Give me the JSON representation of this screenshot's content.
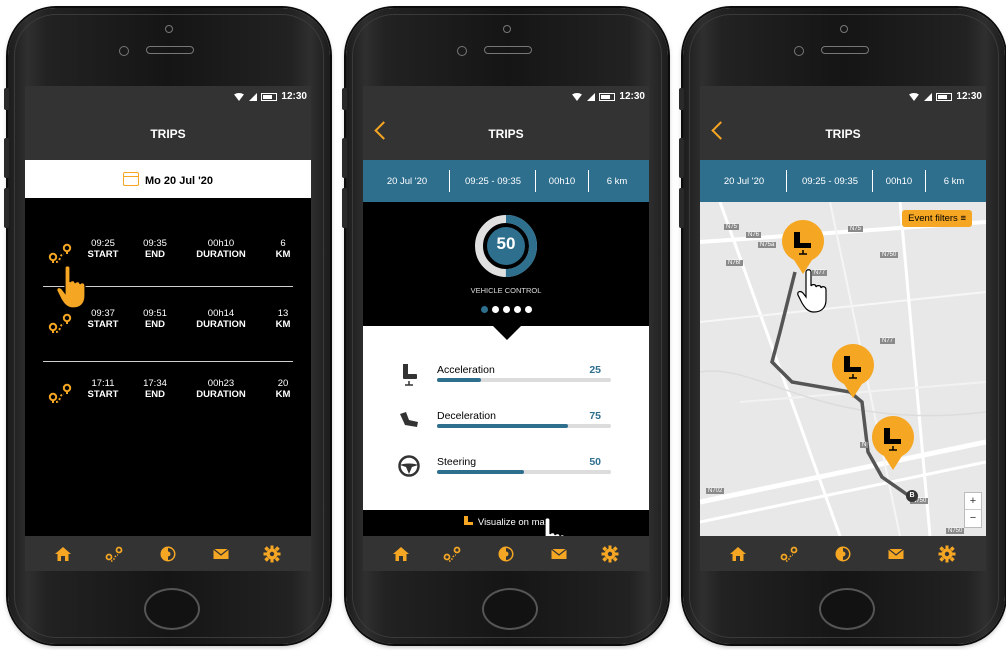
{
  "accent_color": "#f5a623",
  "teal_color": "#2e6f8e",
  "status": {
    "time": "12:30"
  },
  "screen1": {
    "title": "TRIPS",
    "date": "Mo 20 Jul '20",
    "labels": {
      "start": "START",
      "end": "END",
      "duration": "DURATION",
      "km": "KM"
    },
    "trips": [
      {
        "start": "09:25",
        "end": "09:35",
        "duration": "00h10",
        "km": "6"
      },
      {
        "start": "09:37",
        "end": "09:51",
        "duration": "00h14",
        "km": "13"
      },
      {
        "start": "17:11",
        "end": "17:34",
        "duration": "00h23",
        "km": "20"
      }
    ]
  },
  "screen2": {
    "title": "TRIPS",
    "summary": {
      "date": "20 Jul '20",
      "time_range": "09:25 - 09:35",
      "duration": "00h10",
      "distance": "6 km"
    },
    "score": {
      "value": "50",
      "label": "VEHICLE CONTROL",
      "fraction": 0.5
    },
    "metrics": [
      {
        "label": "Acceleration",
        "value": "25",
        "fraction": 0.25
      },
      {
        "label": "Deceleration",
        "value": "75",
        "fraction": 0.75
      },
      {
        "label": "Steering",
        "value": "50",
        "fraction": 0.5
      }
    ],
    "visualize": "Visualize on map"
  },
  "screen3": {
    "title": "TRIPS",
    "summary": {
      "date": "20 Jul '20",
      "time_range": "09:25 - 09:35",
      "duration": "00h10",
      "distance": "6 km"
    },
    "event_filters": "Event filters",
    "zoom_in": "+",
    "zoom_out": "−",
    "roads": [
      "N75",
      "N76",
      "N75a",
      "N76f",
      "N75",
      "N750",
      "N77",
      "N77",
      "750",
      "N",
      "N702",
      "N750",
      "N750"
    ],
    "marker_end": "B"
  },
  "icons": [
    "home-icon",
    "route-icon",
    "score-icon",
    "mail-icon",
    "gear-icon"
  ]
}
